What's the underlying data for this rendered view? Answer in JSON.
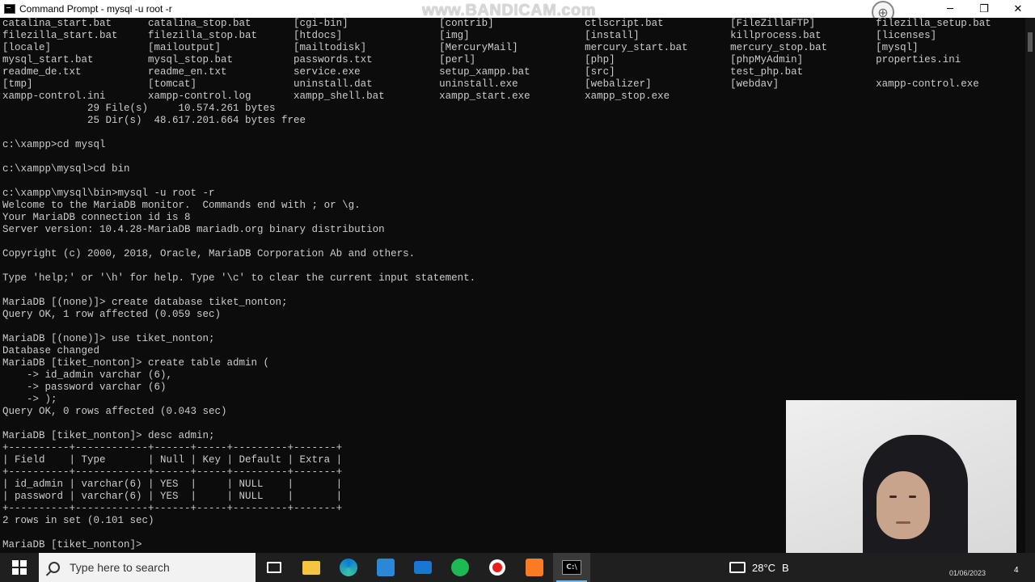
{
  "window": {
    "title": "Command Prompt - mysql  -u root -r",
    "watermark": "www.BANDICAM.com",
    "minimize_glyph": "─",
    "maximize_glyph": "❐",
    "close_glyph": "✕",
    "globe_glyph": "⊕"
  },
  "console": {
    "lines": [
      "catalina_start.bat      catalina_stop.bat       [cgi-bin]               [contrib]               ctlscript.bat           [FileZillaFTP]          filezilla_setup.bat",
      "filezilla_start.bat     filezilla_stop.bat      [htdocs]                [img]                   [install]               killprocess.bat         [licenses]",
      "[locale]                [mailoutput]            [mailtodisk]            [MercuryMail]           mercury_start.bat       mercury_stop.bat        [mysql]",
      "mysql_start.bat         mysql_stop.bat          passwords.txt           [perl]                  [php]                   [phpMyAdmin]            properties.ini",
      "readme_de.txt           readme_en.txt           service.exe             setup_xampp.bat         [src]                   test_php.bat",
      "[tmp]                   [tomcat]                uninstall.dat           uninstall.exe           [webalizer]             [webdav]                xampp-control.exe",
      "xampp-control.ini       xampp-control.log       xampp_shell.bat         xampp_start.exe         xampp_stop.exe",
      "              29 File(s)     10.574.261 bytes",
      "              25 Dir(s)  48.617.201.664 bytes free",
      "",
      "c:\\xampp>cd mysql",
      "",
      "c:\\xampp\\mysql>cd bin",
      "",
      "c:\\xampp\\mysql\\bin>mysql -u root -r",
      "Welcome to the MariaDB monitor.  Commands end with ; or \\g.",
      "Your MariaDB connection id is 8",
      "Server version: 10.4.28-MariaDB mariadb.org binary distribution",
      "",
      "Copyright (c) 2000, 2018, Oracle, MariaDB Corporation Ab and others.",
      "",
      "Type 'help;' or '\\h' for help. Type '\\c' to clear the current input statement.",
      "",
      "MariaDB [(none)]> create database tiket_nonton;",
      "Query OK, 1 row affected (0.059 sec)",
      "",
      "MariaDB [(none)]> use tiket_nonton;",
      "Database changed",
      "MariaDB [tiket_nonton]> create table admin (",
      "    -> id_admin varchar (6),",
      "    -> password varchar (6)",
      "    -> );",
      "Query OK, 0 rows affected (0.043 sec)",
      "",
      "MariaDB [tiket_nonton]> desc admin;",
      "+----------+------------+------+-----+---------+-------+",
      "| Field    | Type       | Null | Key | Default | Extra |",
      "+----------+------------+------+-----+---------+-------+",
      "| id_admin | varchar(6) | YES  |     | NULL    |       |",
      "| password | varchar(6) | YES  |     | NULL    |       |",
      "+----------+------------+------+-----+---------+-------+",
      "2 rows in set (0.101 sec)",
      "",
      "MariaDB [tiket_nonton]> "
    ]
  },
  "taskbar": {
    "search_placeholder": "Type here to search",
    "cmd_icon_text": "C:\\",
    "temperature": "28°C",
    "weather_letter": "B",
    "date": "01/06/2023",
    "badge": "4",
    "apps": [
      "task-view",
      "file-explorer",
      "edge",
      "microsoft-store",
      "mail",
      "spotify",
      "bandicam-record",
      "xampp",
      "command-prompt"
    ]
  }
}
